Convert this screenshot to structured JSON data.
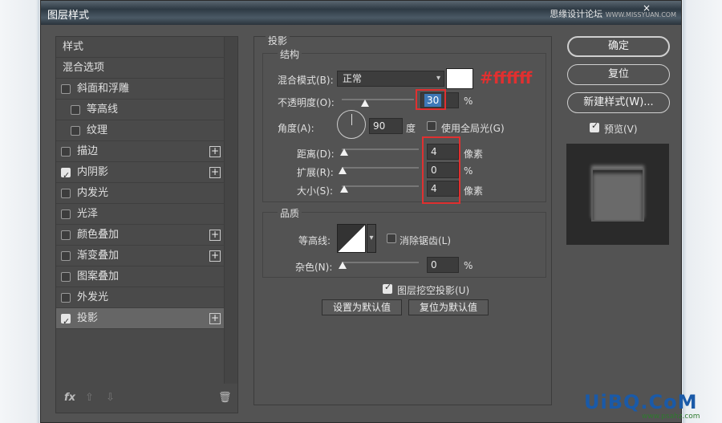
{
  "window": {
    "title": "图层样式",
    "close_glyph": "×",
    "watermark": "思缘设计论坛",
    "watermark_small": "WWW.MISSYUAN.COM"
  },
  "styles_list": {
    "header": "样式",
    "blend_options": "混合选项",
    "items": [
      {
        "label": "斜面和浮雕",
        "checked": false,
        "indent": false,
        "plus": false
      },
      {
        "label": "等高线",
        "checked": false,
        "indent": true,
        "plus": false
      },
      {
        "label": "纹理",
        "checked": false,
        "indent": true,
        "plus": false
      },
      {
        "label": "描边",
        "checked": false,
        "indent": false,
        "plus": true
      },
      {
        "label": "内阴影",
        "checked": true,
        "indent": false,
        "plus": true
      },
      {
        "label": "内发光",
        "checked": false,
        "indent": false,
        "plus": false
      },
      {
        "label": "光泽",
        "checked": false,
        "indent": false,
        "plus": false
      },
      {
        "label": "颜色叠加",
        "checked": false,
        "indent": false,
        "plus": true
      },
      {
        "label": "渐变叠加",
        "checked": false,
        "indent": false,
        "plus": true
      },
      {
        "label": "图案叠加",
        "checked": false,
        "indent": false,
        "plus": false
      },
      {
        "label": "外发光",
        "checked": false,
        "indent": false,
        "plus": false
      },
      {
        "label": "投影",
        "checked": true,
        "indent": false,
        "plus": true,
        "selected": true
      }
    ],
    "bottom": {
      "fx": "fx",
      "up": "⇧",
      "down": "⇩",
      "trash": "🗑"
    }
  },
  "drop_shadow": {
    "section_title": "投影",
    "structure": {
      "title": "结构",
      "blend_mode_label": "混合模式(B):",
      "blend_mode_value": "正常",
      "color_hex_annotation": "#ffffff",
      "opacity_label": "不透明度(O):",
      "opacity_value": "30",
      "opacity_unit": "%",
      "angle_label": "角度(A):",
      "angle_value": "90",
      "angle_unit": "度",
      "global_light_label": "使用全局光(G)",
      "distance_label": "距离(D):",
      "distance_value": "4",
      "distance_unit": "像素",
      "spread_label": "扩展(R):",
      "spread_value": "0",
      "spread_unit": "%",
      "size_label": "大小(S):",
      "size_value": "4",
      "size_unit": "像素"
    },
    "quality": {
      "title": "品质",
      "contour_label": "等高线:",
      "anti_alias_label": "消除锯齿(L)",
      "noise_label": "杂色(N):",
      "noise_value": "0",
      "noise_unit": "%"
    },
    "knockout_label": "图层挖空投影(U)",
    "make_default": "设置为默认值",
    "reset_default": "复位为默认值"
  },
  "right": {
    "ok": "确定",
    "reset": "复位",
    "new_style": "新建样式(W)...",
    "preview_label": "预览(V)"
  },
  "brand_watermark": {
    "text": "UiBQ.CoM",
    "small": "www.psahz.com"
  },
  "colors": {
    "annotation_red": "#e03030",
    "dialog_bg": "#535353",
    "highlight_blue": "#3e78b7"
  }
}
